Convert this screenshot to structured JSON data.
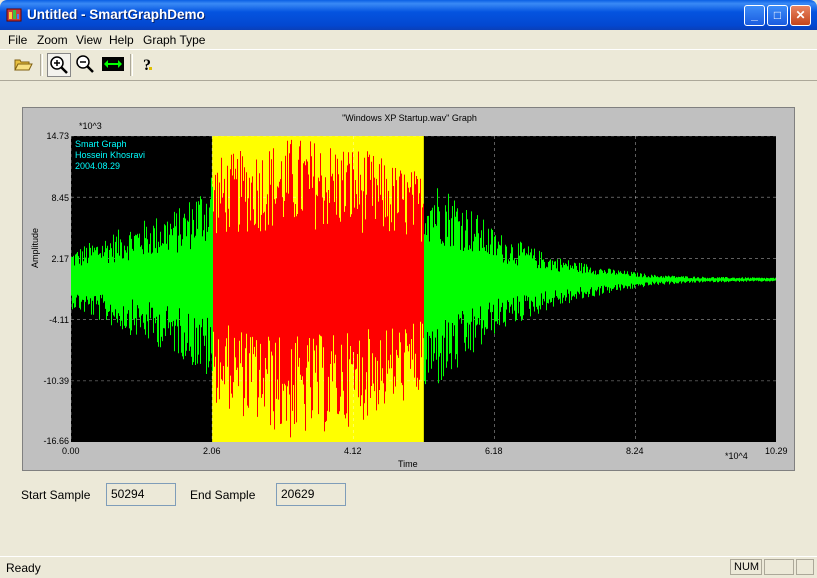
{
  "window": {
    "title": "Untitled - SmartGraphDemo",
    "minimize_glyph": "_",
    "maximize_glyph": "□",
    "close_glyph": "✕"
  },
  "menu": [
    {
      "label": "File"
    },
    {
      "label": "Zoom"
    },
    {
      "label": "View"
    },
    {
      "label": "Help"
    },
    {
      "label": "Graph Type"
    }
  ],
  "toolbar": {
    "open_icon": "folder-open-icon",
    "zoom_in_icon": "magnifier-plus-icon",
    "zoom_out_icon": "magnifier-minus-icon",
    "fit_icon": "horizontal-arrows-icon",
    "help_icon": "question-mark-icon"
  },
  "graph": {
    "title": "\"Windows XP Startup.wav\" Graph",
    "y_multiplier": "*10^3",
    "x_multiplier": "*10^4",
    "ylabel": "Amplitude",
    "xlabel": "Time",
    "watermark_line1": "Smart Graph",
    "watermark_line2": "Hossein Khosravi",
    "watermark_line3": "2004.08.29",
    "y_ticks": [
      "14.73",
      "8.45",
      "2.17",
      "-4.11",
      "-10.39",
      "-16.66"
    ],
    "x_ticks": [
      "0.00",
      "2.06",
      "4.12",
      "6.18",
      "8.24",
      "10.29"
    ]
  },
  "chart_data": {
    "type": "area",
    "title": "\"Windows XP Startup.wav\" Graph",
    "xlabel": "Time",
    "ylabel": "Amplitude",
    "xlim": [
      0.0,
      10.29
    ],
    "ylim": [
      -16.66,
      14.73
    ],
    "grid": true,
    "selection": {
      "x_start": 2.06,
      "x_end": 5.15
    },
    "colors": {
      "background": "#000000",
      "signal": "#00ff00",
      "selected_signal": "#ff0000",
      "selection_fill": "#ffff00",
      "watermark": "#00ffff",
      "grid": "#ffffff"
    },
    "envelope": {
      "x": [
        0.0,
        0.8,
        1.6,
        2.0,
        2.06,
        2.6,
        3.2,
        3.6,
        4.1,
        4.7,
        5.15,
        5.6,
        6.2,
        7.0,
        7.8,
        8.5,
        9.2,
        10.29
      ],
      "upper": [
        3.0,
        5.5,
        7.5,
        10.5,
        12.5,
        13.5,
        14.7,
        14.5,
        14.0,
        12.0,
        11.0,
        9.0,
        5.0,
        2.5,
        1.2,
        0.5,
        0.3,
        0.2
      ],
      "lower": [
        -3.0,
        -5.5,
        -8.0,
        -10.5,
        -12.5,
        -14.5,
        -16.6,
        -16.0,
        -15.0,
        -13.0,
        -12.0,
        -10.0,
        -5.5,
        -3.0,
        -1.5,
        -0.6,
        -0.3,
        -0.2
      ]
    }
  },
  "fields": {
    "start_label": "Start Sample",
    "start_value": "50294",
    "end_label": "End Sample",
    "end_value": "20629"
  },
  "status": {
    "text": "Ready",
    "num": "NUM"
  }
}
